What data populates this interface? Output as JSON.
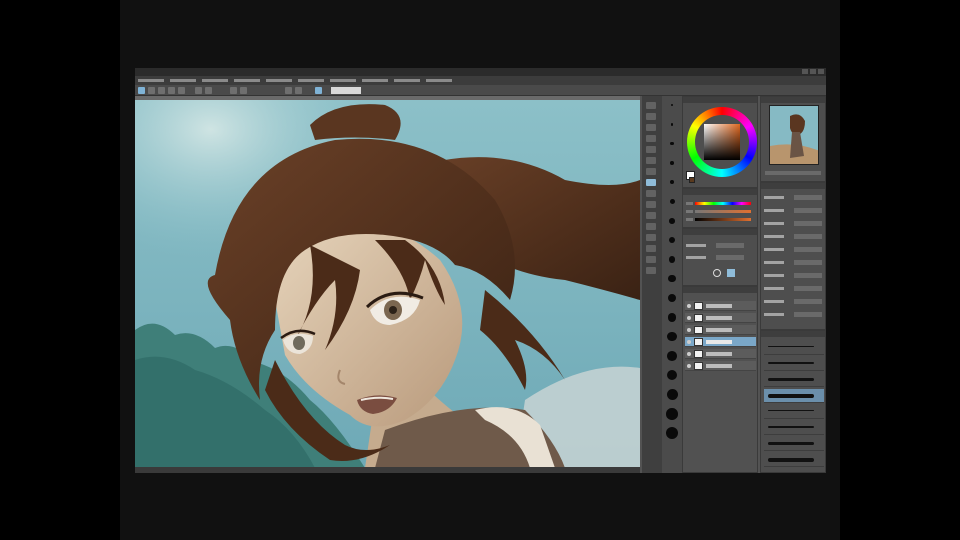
{
  "window": {
    "title": "",
    "menus": [
      "",
      "",
      "",
      "",
      "",
      "",
      "",
      "",
      "",
      ""
    ]
  },
  "colors": {
    "sky": "#7fb6c2",
    "hair": "#5a3620",
    "skin": "#d9c3a6",
    "ui_panel": "#4e4e4e",
    "ui_dark": "#3a3a3a",
    "selection": "#7aa7c8"
  },
  "icons": {
    "tools": [
      "move-icon",
      "zoom-icon",
      "select-icon",
      "lasso-icon",
      "eyedropper-icon",
      "pen-icon",
      "pencil-icon",
      "brush-icon",
      "airbrush-icon",
      "blend-icon",
      "eraser-icon",
      "fill-icon",
      "gradient-icon",
      "text-icon",
      "ruler-icon",
      "figure-icon"
    ]
  },
  "brush_sizes": [
    1,
    1.5,
    2,
    2.5,
    3,
    4,
    5,
    6,
    7,
    8,
    10,
    12,
    15,
    17,
    20,
    25,
    30,
    40
  ],
  "layers": {
    "selected_index": 3,
    "rows": [
      "layer-1",
      "layer-2",
      "layer-3",
      "layer-4",
      "layer-5",
      "layer-6"
    ]
  }
}
